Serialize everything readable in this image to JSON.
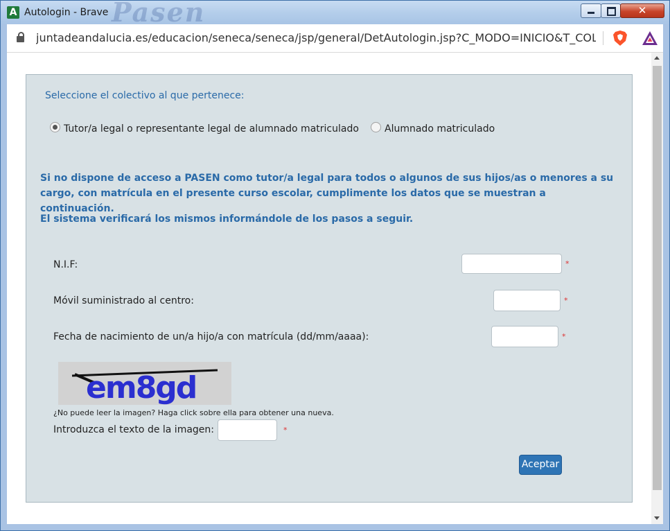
{
  "window": {
    "title": "Autologin - Brave",
    "app_icon_letter": "A",
    "background_word": "Pasen",
    "controls": {
      "close_glyph": "✕"
    }
  },
  "addressbar": {
    "url": "juntadeandalucia.es/educacion/seneca/seneca/jsp/general/DetAutologin.jsp?C_MODO=INICIO&T_COL..."
  },
  "form": {
    "heading": "Seleccione el colectivo al que pertenece:",
    "options": [
      {
        "label": "Tutor/a legal o representante legal de alumnado matriculado",
        "checked": true
      },
      {
        "label": "Alumnado matriculado",
        "checked": false
      }
    ],
    "info1": "Si no dispone de acceso a PASEN como tutor/a legal para todos o algunos de sus hijos/as o menores a su cargo, con matrícula en el presente curso escolar, cumplimente los datos que se muestran a continuación.",
    "info2": "El sistema verificará los mismos informándole de los pasos a seguir.",
    "fields": {
      "nif": {
        "label": "N.I.F:",
        "value": ""
      },
      "movil": {
        "label": "Móvil suministrado al centro:",
        "value": ""
      },
      "fecha": {
        "label": "Fecha de nacimiento de un/a hijo/a con matrícula (dd/mm/aaaa):",
        "value": ""
      }
    },
    "required_mark": "*",
    "captcha": {
      "text": "em8gd",
      "hint": "¿No puede leer la imagen? Haga click sobre ella para obtener una nueva.",
      "input_label": "Introduzca el texto de la imagen:",
      "value": ""
    },
    "submit_label": "Aceptar"
  },
  "colors": {
    "accent": "#2a6aa8",
    "button": "#2e74b5",
    "panel": "#d8e1e5",
    "required": "#dd3333"
  }
}
